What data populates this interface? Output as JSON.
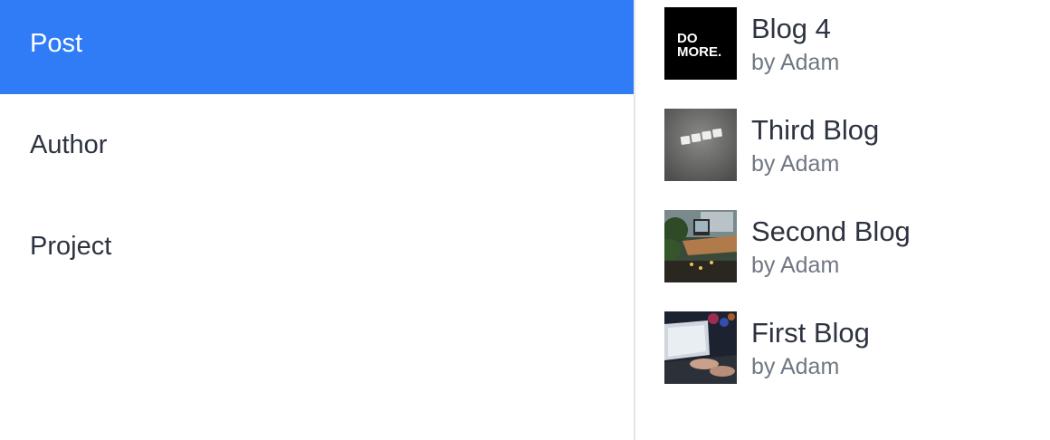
{
  "nav": {
    "items": [
      {
        "label": "Post",
        "active": true
      },
      {
        "label": "Author",
        "active": false
      },
      {
        "label": "Project",
        "active": false
      }
    ]
  },
  "posts": [
    {
      "title": "Blog 4",
      "author": "by Adam",
      "thumb": "do-more-image",
      "thumb_text": [
        "DO",
        "MORE."
      ]
    },
    {
      "title": "Third Blog",
      "author": "by Adam",
      "thumb": "scrabble-tiles-image"
    },
    {
      "title": "Second Blog",
      "author": "by Adam",
      "thumb": "desk-workspace-image"
    },
    {
      "title": "First Blog",
      "author": "by Adam",
      "thumb": "laptop-typing-image"
    }
  ],
  "colors": {
    "accent": "#2f7cf6",
    "text": "#2d3340",
    "muted": "#707784",
    "divider": "#e2e6ea"
  }
}
